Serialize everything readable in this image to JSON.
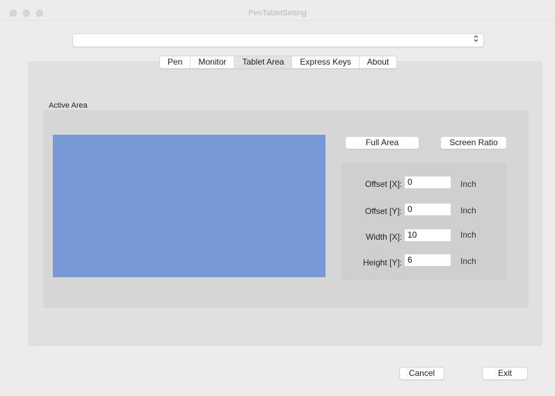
{
  "window": {
    "title": "PenTabletSetting"
  },
  "device_select": {
    "value": "",
    "icon": "updown-chevron-icon"
  },
  "tabs": [
    {
      "label": "Pen",
      "selected": false
    },
    {
      "label": "Monitor",
      "selected": false
    },
    {
      "label": "Tablet Area",
      "selected": true
    },
    {
      "label": "Express Keys",
      "selected": false
    },
    {
      "label": "About",
      "selected": false
    }
  ],
  "active_area": {
    "label": "Active Area",
    "preview_color": "#7799d6",
    "full_area_label": "Full Area",
    "screen_ratio_label": "Screen Ratio",
    "fields": [
      {
        "label": "Offset [X]:",
        "value": "0",
        "unit": "Inch"
      },
      {
        "label": "Offset [Y]:",
        "value": "0",
        "unit": "Inch"
      },
      {
        "label": "Width [X]:",
        "value": "10",
        "unit": "Inch"
      },
      {
        "label": "Height [Y]:",
        "value": "6",
        "unit": "Inch"
      }
    ]
  },
  "footer": {
    "cancel_label": "Cancel",
    "exit_label": "Exit"
  }
}
